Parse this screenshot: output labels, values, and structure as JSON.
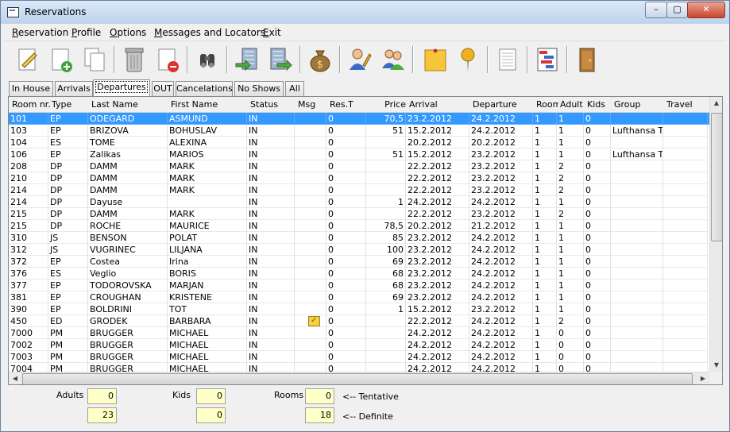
{
  "window": {
    "title": "Reservations",
    "min_label": "–",
    "max_label": "▢",
    "close_label": "✕"
  },
  "menu": [
    "Reservation",
    "Profile",
    "Options",
    "Messages and Locators",
    "Exit"
  ],
  "toolbar_icons": [
    "edit-reservation-icon",
    "new-reservation-icon",
    "copy-reservation-icon",
    "delete-trash-icon",
    "cancel-reservation-icon",
    "search-binoculars-icon",
    "check-in-icon",
    "check-out-icon",
    "billing-moneybag-icon",
    "edit-guest-icon",
    "group-guests-icon",
    "note-icon",
    "locator-pin-icon",
    "report-icon",
    "room-plan-icon",
    "exit-door-icon"
  ],
  "tabs": [
    "In House",
    "Arrivals",
    "Departures",
    "OUT",
    "Cancelations",
    "No Shows",
    "All"
  ],
  "active_tab": "Departures",
  "columns": [
    "Room nr.",
    "Type",
    "Last Name",
    "First Name",
    "Status",
    "Msg",
    "Res.T",
    "Price",
    "Arrival",
    "Departure",
    "Room",
    "Adult",
    "Kids",
    "Group",
    "Travel"
  ],
  "rows": [
    [
      "101",
      "EP",
      "ODEGARD",
      "ASMUND",
      "IN",
      "",
      "0",
      "70,5",
      "23.2.2012",
      "24.2.2012",
      "1",
      "1",
      "0",
      "",
      ""
    ],
    [
      "103",
      "EP",
      "BRIZOVA",
      "BOHUSLAV",
      "IN",
      "",
      "0",
      "51",
      "15.2.2012",
      "24.2.2012",
      "1",
      "1",
      "0",
      "Lufthansa Te",
      ""
    ],
    [
      "104",
      "ES",
      "TOME",
      "ALEXINA",
      "IN",
      "",
      "0",
      "",
      "20.2.2012",
      "20.2.2012",
      "1",
      "1",
      "0",
      "",
      ""
    ],
    [
      "106",
      "EP",
      "Zalikas",
      "MARIOS",
      "IN",
      "",
      "0",
      "51",
      "15.2.2012",
      "23.2.2012",
      "1",
      "1",
      "0",
      "Lufthansa Te",
      ""
    ],
    [
      "208",
      "DP",
      "DAMM",
      "MARK",
      "IN",
      "",
      "0",
      "",
      "22.2.2012",
      "23.2.2012",
      "1",
      "2",
      "0",
      "",
      ""
    ],
    [
      "210",
      "DP",
      "DAMM",
      "MARK",
      "IN",
      "",
      "0",
      "",
      "22.2.2012",
      "23.2.2012",
      "1",
      "2",
      "0",
      "",
      ""
    ],
    [
      "214",
      "DP",
      "DAMM",
      "MARK",
      "IN",
      "",
      "0",
      "",
      "22.2.2012",
      "23.2.2012",
      "1",
      "2",
      "0",
      "",
      ""
    ],
    [
      "214",
      "DP",
      "Dayuse",
      "",
      "IN",
      "",
      "0",
      "1",
      "24.2.2012",
      "24.2.2012",
      "1",
      "1",
      "0",
      "",
      ""
    ],
    [
      "215",
      "DP",
      "DAMM",
      "MARK",
      "IN",
      "",
      "0",
      "",
      "22.2.2012",
      "23.2.2012",
      "1",
      "2",
      "0",
      "",
      ""
    ],
    [
      "215",
      "DP",
      "ROCHE",
      "MAURICE",
      "IN",
      "",
      "0",
      "78,5",
      "20.2.2012",
      "21.2.2012",
      "1",
      "1",
      "0",
      "",
      ""
    ],
    [
      "310",
      "JS",
      "BENSON",
      "POLAT",
      "IN",
      "",
      "0",
      "85",
      "23.2.2012",
      "24.2.2012",
      "1",
      "1",
      "0",
      "",
      ""
    ],
    [
      "312",
      "JS",
      "VUGRINEC",
      "LILJANA",
      "IN",
      "",
      "0",
      "100",
      "23.2.2012",
      "24.2.2012",
      "1",
      "1",
      "0",
      "",
      ""
    ],
    [
      "372",
      "EP",
      "Costea",
      "Irina",
      "IN",
      "",
      "0",
      "69",
      "23.2.2012",
      "24.2.2012",
      "1",
      "1",
      "0",
      "",
      ""
    ],
    [
      "376",
      "ES",
      "Veglio",
      "BORIS",
      "IN",
      "",
      "0",
      "68",
      "23.2.2012",
      "24.2.2012",
      "1",
      "1",
      "0",
      "",
      ""
    ],
    [
      "377",
      "EP",
      "TODOROVSKA",
      "MARJAN",
      "IN",
      "",
      "0",
      "68",
      "23.2.2012",
      "24.2.2012",
      "1",
      "1",
      "0",
      "",
      ""
    ],
    [
      "381",
      "EP",
      "CROUGHAN",
      "KRISTENE",
      "IN",
      "",
      "0",
      "69",
      "23.2.2012",
      "24.2.2012",
      "1",
      "1",
      "0",
      "",
      ""
    ],
    [
      "390",
      "EP",
      "BOLDRINI",
      "TOT",
      "IN",
      "",
      "0",
      "1",
      "15.2.2012",
      "23.2.2012",
      "1",
      "1",
      "0",
      "",
      ""
    ],
    [
      "450",
      "ED",
      "GRODEK",
      "BARBARA",
      "IN",
      "message-icon",
      "0",
      "",
      "22.2.2012",
      "24.2.2012",
      "1",
      "2",
      "0",
      "",
      ""
    ],
    [
      "7000",
      "PM",
      "BRUGGER",
      "MICHAEL",
      "IN",
      "",
      "0",
      "",
      "24.2.2012",
      "24.2.2012",
      "1",
      "0",
      "0",
      "",
      ""
    ],
    [
      "7002",
      "PM",
      "BRUGGER",
      "MICHAEL",
      "IN",
      "",
      "0",
      "",
      "24.2.2012",
      "24.2.2012",
      "1",
      "0",
      "0",
      "",
      ""
    ],
    [
      "7003",
      "PM",
      "BRUGGER",
      "MICHAEL",
      "IN",
      "",
      "0",
      "",
      "24.2.2012",
      "24.2.2012",
      "1",
      "0",
      "0",
      "",
      ""
    ],
    [
      "7004",
      "PM",
      "BRUGGER",
      "MICHAEL",
      "IN",
      "",
      "0",
      "",
      "24.2.2012",
      "24.2.2012",
      "1",
      "0",
      "0",
      "",
      ""
    ]
  ],
  "selected_row": 0,
  "footer": {
    "adults_label": "Adults",
    "kids_label": "Kids",
    "rooms_label": "Rooms",
    "tentative_adults": "0",
    "tentative_kids": "0",
    "tentative_rooms": "0",
    "definite_adults": "23",
    "definite_kids": "0",
    "definite_rooms": "18",
    "tentative_label": "<-- Tentative",
    "definite_label": "<-- Definite"
  },
  "colors": {
    "selection": "#3399ff",
    "footer_field": "#ffffc8"
  }
}
